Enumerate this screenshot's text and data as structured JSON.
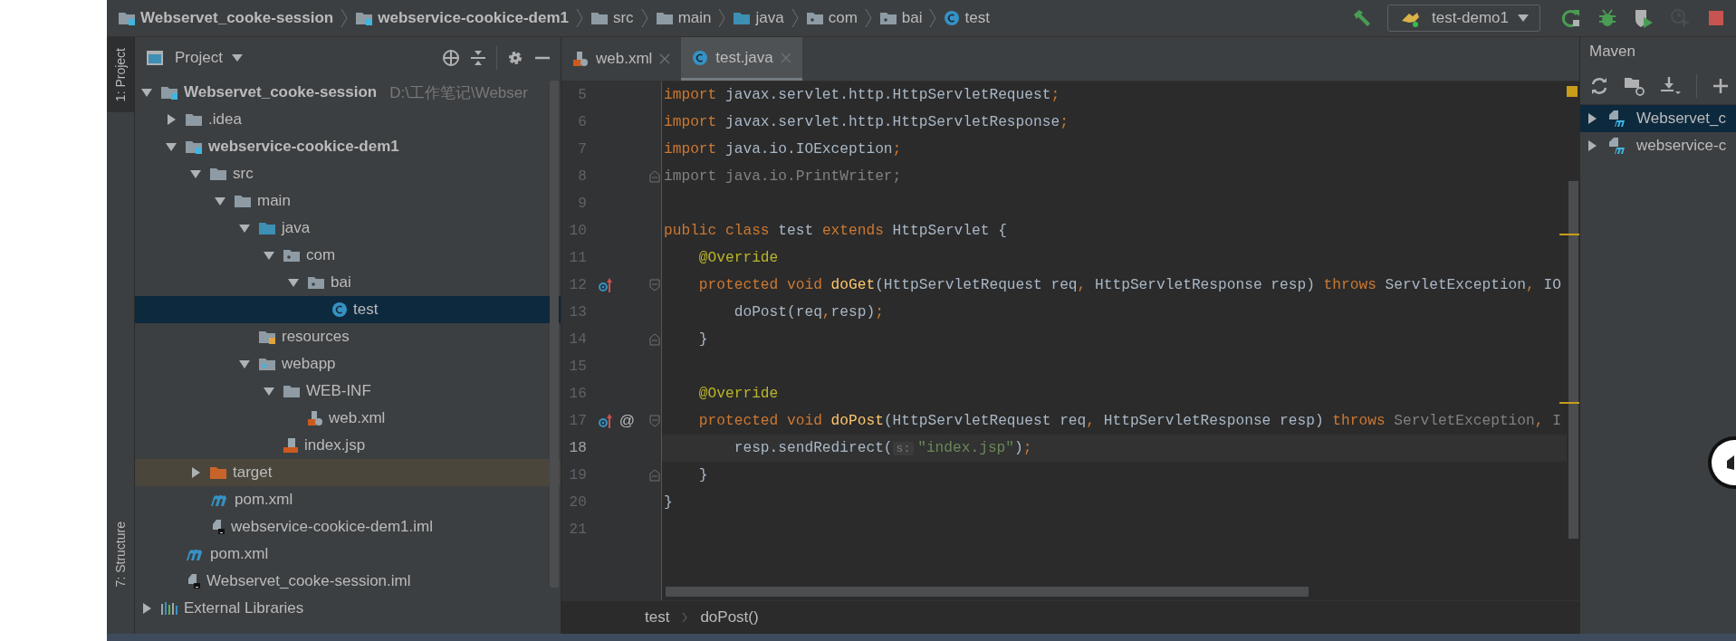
{
  "navbar": {
    "crumbs": [
      {
        "label": "Webservet_cooke-session",
        "kind": "module"
      },
      {
        "label": "webservice-cookice-dem1",
        "kind": "module"
      },
      {
        "label": "src",
        "kind": "folder"
      },
      {
        "label": "main",
        "kind": "folder"
      },
      {
        "label": "java",
        "kind": "source"
      },
      {
        "label": "com",
        "kind": "package"
      },
      {
        "label": "bai",
        "kind": "package"
      },
      {
        "label": "test",
        "kind": "class"
      }
    ],
    "run_config": {
      "label": "test-demo1"
    },
    "toolbar_buttons": [
      {
        "kind": "rerun",
        "disabled": false
      },
      {
        "kind": "debug",
        "disabled": false
      },
      {
        "kind": "coverage",
        "disabled": false
      },
      {
        "kind": "profile",
        "disabled": true
      },
      {
        "kind": "stop",
        "disabled": false
      }
    ]
  },
  "tool_strip": [
    {
      "label": "1: Project",
      "selected": true
    },
    {
      "label": "7: Structure",
      "selected": false
    }
  ],
  "project": {
    "title": "Project",
    "tree": [
      {
        "label": "Webservet_cooke-session",
        "hint": "D:\\工作笔记\\Webser",
        "kind": "module",
        "expanded": true,
        "selected": false,
        "children": [
          {
            "label": ".idea",
            "kind": "folder",
            "expanded": false,
            "selected": false
          },
          {
            "label": "webservice-cookice-dem1",
            "kind": "module",
            "expanded": true,
            "selected": false,
            "children": [
              {
                "label": "src",
                "kind": "folder",
                "expanded": true,
                "selected": false,
                "children": [
                  {
                    "label": "main",
                    "kind": "folder",
                    "expanded": true,
                    "selected": false,
                    "children": [
                      {
                        "label": "java",
                        "kind": "source",
                        "expanded": true,
                        "selected": false,
                        "children": [
                          {
                            "label": "com",
                            "kind": "package",
                            "expanded": true,
                            "selected": false,
                            "children": [
                              {
                                "label": "bai",
                                "kind": "package",
                                "expanded": true,
                                "selected": false,
                                "children": [
                                  {
                                    "label": "test",
                                    "kind": "class",
                                    "selected": true
                                  }
                                ]
                              }
                            ]
                          }
                        ]
                      },
                      {
                        "label": "resources",
                        "kind": "resources",
                        "selected": false
                      },
                      {
                        "label": "webapp",
                        "kind": "webapp",
                        "expanded": true,
                        "selected": false,
                        "children": [
                          {
                            "label": "WEB-INF",
                            "kind": "folder",
                            "expanded": true,
                            "selected": false,
                            "children": [
                              {
                                "label": "web.xml",
                                "kind": "xml",
                                "selected": false
                              }
                            ]
                          },
                          {
                            "label": "index.jsp",
                            "kind": "jsp",
                            "selected": false
                          }
                        ]
                      }
                    ]
                  }
                ]
              },
              {
                "label": "target",
                "kind": "excluded",
                "expanded": false,
                "selected": false
              },
              {
                "label": "pom.xml",
                "kind": "maven",
                "selected": false
              },
              {
                "label": "webservice-cookice-dem1.iml",
                "kind": "iml",
                "selected": false
              }
            ]
          },
          {
            "label": "pom.xml",
            "kind": "maven",
            "selected": false
          },
          {
            "label": "Webservet_cooke-session.iml",
            "kind": "iml",
            "selected": false
          }
        ]
      },
      {
        "label": "External Libraries",
        "kind": "libraries",
        "expanded": false,
        "selected": false
      }
    ]
  },
  "editor": {
    "tabs": [
      {
        "label": "web.xml",
        "kind": "xml",
        "selected": false
      },
      {
        "label": "test.java",
        "kind": "class",
        "selected": true
      }
    ],
    "lines": [
      {
        "number": "5",
        "current": false,
        "tokens": [
          {
            "kind": "kw",
            "text": "import "
          },
          {
            "kind": "plain",
            "text": "javax.servlet.http.HttpServletRequest"
          },
          {
            "kind": "kw",
            "text": ";"
          }
        ]
      },
      {
        "number": "6",
        "current": false,
        "tokens": [
          {
            "kind": "kw",
            "text": "import "
          },
          {
            "kind": "plain",
            "text": "javax.servlet.http.HttpServletResponse"
          },
          {
            "kind": "kw",
            "text": ";"
          }
        ]
      },
      {
        "number": "7",
        "current": false,
        "tokens": [
          {
            "kind": "kw",
            "text": "import "
          },
          {
            "kind": "plain",
            "text": "java.io.IOException"
          },
          {
            "kind": "kw",
            "text": ";"
          }
        ]
      },
      {
        "number": "8",
        "current": false,
        "gutter": [
          {
            "kind": "fold-end"
          }
        ],
        "tokens": [
          {
            "kind": "unused",
            "text": "import java.io.PrintWriter;"
          }
        ]
      },
      {
        "number": "9",
        "current": false
      },
      {
        "number": "10",
        "current": false,
        "tokens": [
          {
            "kind": "kw",
            "text": "public class "
          },
          {
            "kind": "plain",
            "text": "test "
          },
          {
            "kind": "kw",
            "text": "extends "
          },
          {
            "kind": "plain",
            "text": "HttpServlet {"
          }
        ]
      },
      {
        "number": "11",
        "current": false,
        "tokens": [
          {
            "kind": "annotation",
            "text": "    @Override"
          }
        ]
      },
      {
        "number": "12",
        "current": false,
        "gutter": [
          {
            "kind": "override"
          },
          {
            "kind": "fold-start"
          }
        ],
        "tokens": [
          {
            "kind": "kw",
            "text": "    protected void "
          },
          {
            "kind": "method",
            "text": "doGet"
          },
          {
            "kind": "plain",
            "text": "(HttpServletRequest req"
          },
          {
            "kind": "kw",
            "text": ", "
          },
          {
            "kind": "plain",
            "text": "HttpServletResponse resp) "
          },
          {
            "kind": "kw",
            "text": "throws "
          },
          {
            "kind": "plain",
            "text": "ServletException"
          },
          {
            "kind": "kw",
            "text": ", "
          },
          {
            "kind": "plain",
            "text": "IO"
          }
        ]
      },
      {
        "number": "13",
        "current": false,
        "tokens": [
          {
            "kind": "plain",
            "text": "        doPost(req"
          },
          {
            "kind": "kw",
            "text": ","
          },
          {
            "kind": "plain",
            "text": "resp)"
          },
          {
            "kind": "kw",
            "text": ";"
          }
        ]
      },
      {
        "number": "14",
        "current": false,
        "gutter": [
          {
            "kind": "fold-end"
          }
        ],
        "tokens": [
          {
            "kind": "plain",
            "text": "    }"
          }
        ]
      },
      {
        "number": "15",
        "current": false
      },
      {
        "number": "16",
        "current": false,
        "tokens": [
          {
            "kind": "annotation",
            "text": "    @Override"
          }
        ]
      },
      {
        "number": "17",
        "current": false,
        "gutter": [
          {
            "kind": "override"
          },
          {
            "kind": "text",
            "text": "@"
          },
          {
            "kind": "fold-start"
          }
        ],
        "tokens": [
          {
            "kind": "kw",
            "text": "    protected void "
          },
          {
            "kind": "method",
            "text": "doPost"
          },
          {
            "kind": "plain",
            "text": "(HttpServletRequest req"
          },
          {
            "kind": "kw",
            "text": ", "
          },
          {
            "kind": "plain",
            "text": "HttpServletResponse resp) "
          },
          {
            "kind": "kw",
            "text": "throws "
          },
          {
            "kind": "unused",
            "text": "ServletException"
          },
          {
            "kind": "kw",
            "text": ", "
          },
          {
            "kind": "unused",
            "text": "I"
          }
        ]
      },
      {
        "number": "18",
        "current": true,
        "tokens": [
          {
            "kind": "plain",
            "text": "        resp.sendRedirect("
          },
          {
            "kind": "hint",
            "text": "s:"
          },
          {
            "kind": "string",
            "text": "\"index.jsp\""
          },
          {
            "kind": "plain",
            "text": ")"
          },
          {
            "kind": "kw",
            "text": ";"
          }
        ]
      },
      {
        "number": "19",
        "current": false,
        "gutter": [
          {
            "kind": "fold-end"
          }
        ],
        "tokens": [
          {
            "kind": "plain",
            "text": "    }"
          }
        ]
      },
      {
        "number": "20",
        "current": false,
        "tokens": [
          {
            "kind": "plain",
            "text": "}"
          }
        ]
      },
      {
        "number": "21",
        "current": false
      }
    ],
    "breadcrumbs": [
      "test",
      "doPost()"
    ]
  },
  "maven": {
    "title": "Maven",
    "items": [
      {
        "label": "Webservet_c",
        "selected": true,
        "expanded": false
      },
      {
        "label": "webservice-c",
        "selected": false,
        "expanded": false
      }
    ]
  }
}
